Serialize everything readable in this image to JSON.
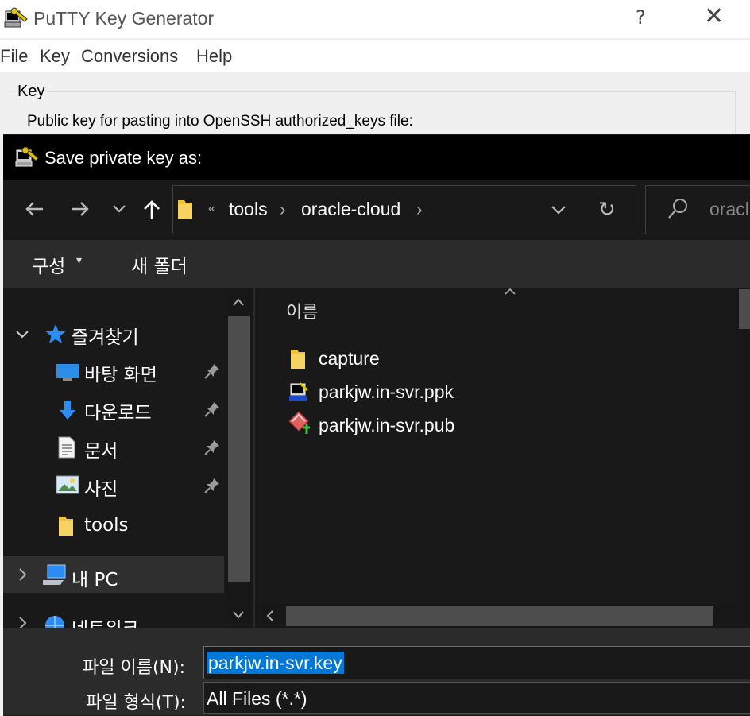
{
  "putty": {
    "title": "PuTTY Key Generator",
    "help_glyph": "?",
    "close_glyph": "✕",
    "menu": [
      "File",
      "Key",
      "Conversions",
      "Help"
    ],
    "group_label": "Key",
    "pubkey_label": "Public key for pasting into OpenSSH authorized_keys file:"
  },
  "dialog": {
    "title": "Save private key as:",
    "nav": {
      "back": "←",
      "forward": "→",
      "recent": "⌄",
      "up": "↑"
    },
    "breadcrumb": {
      "overflow": "«",
      "items": [
        "tools",
        "oracle-cloud"
      ],
      "sep": "›"
    },
    "address_dropdown": "⌄",
    "refresh": "↻",
    "search_placeholder": "oracl",
    "commands": {
      "organize": "구성",
      "organize_caret": "▾",
      "new_folder": "새 폴더"
    },
    "nav_pane": {
      "quick_access": "즐겨찾기",
      "items": [
        "바탕 화면",
        "다운로드",
        "문서",
        "사진",
        "tools"
      ],
      "this_pc": "내 PC",
      "network": "네트워크"
    },
    "file_list": {
      "column_name": "이름",
      "files": [
        "capture",
        "parkjw.in-svr.ppk",
        "parkjw.in-svr.pub"
      ]
    },
    "filename_label": "파일 이름(N):",
    "filename_value": "parkjw.in-svr.key",
    "filetype_label": "파일 형식(T):",
    "filetype_value": "All Files (*.*)"
  },
  "colors": {
    "dialog_bg": "#191919",
    "selection": "#0078d7",
    "folder": "#f0c33c"
  }
}
